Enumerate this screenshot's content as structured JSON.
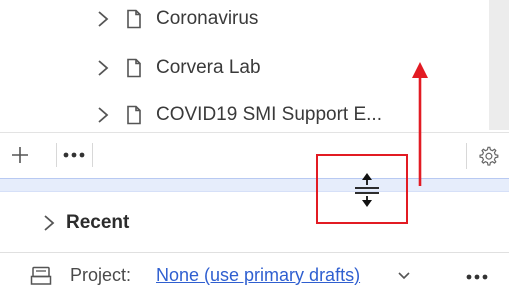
{
  "tree": {
    "items": [
      {
        "label": "Coronavirus",
        "icon": "document-icon"
      },
      {
        "label": "Corvera Lab",
        "icon": "document-icon"
      },
      {
        "label": "COVID19 SMI Support E...",
        "icon": "document-icon"
      }
    ]
  },
  "toolbar": {
    "add_icon": "plus-icon",
    "more_icon": "more-horizontal-icon",
    "settings_icon": "gear-icon"
  },
  "recent": {
    "label": "Recent"
  },
  "project": {
    "label": "Project:",
    "value": "None (use primary drafts)",
    "icon": "project-icon",
    "more_icon": "more-horizontal-icon"
  },
  "annotation": {
    "color": "#e21b23",
    "cursor": "row-resize-cursor-icon"
  },
  "colors": {
    "link": "#2f5fd0",
    "divider": "#e6edfb",
    "annotation": "#e21b23"
  }
}
